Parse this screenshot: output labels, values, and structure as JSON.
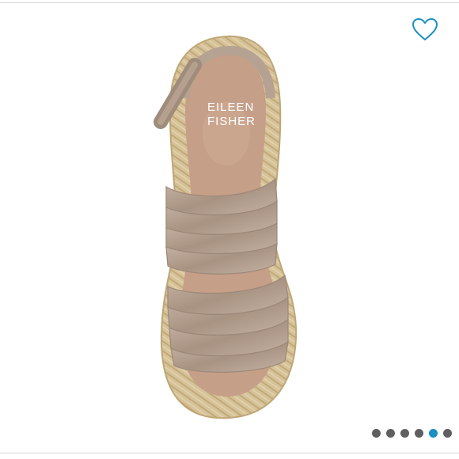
{
  "product": {
    "brand": {
      "line1": "EILEEN",
      "line2": "FISHER"
    }
  },
  "favorite": {
    "icon": "heart-icon",
    "state": "not-favorited",
    "color": "#1a8fc1"
  },
  "carousel": {
    "count": 6,
    "active_index": 4,
    "active_color": "#1a8fc1",
    "inactive_color": "#5f5f5f"
  },
  "colors": {
    "leather": "#b9a596",
    "footbed": "#c9a08a",
    "jute": "#d4c095"
  }
}
